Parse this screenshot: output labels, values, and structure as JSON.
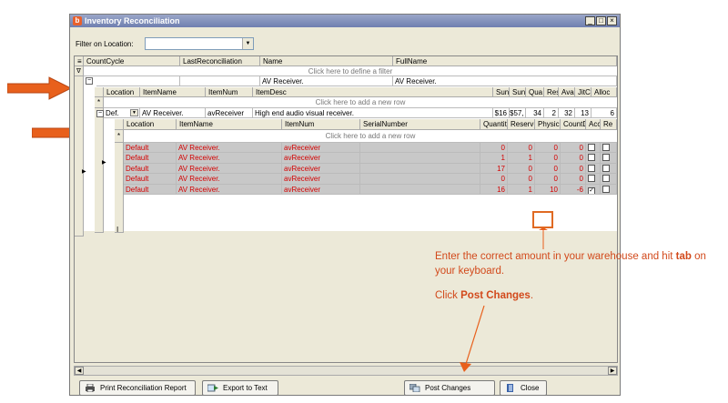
{
  "window": {
    "title": "Inventory Reconciliation",
    "icon_letter": "b",
    "buttons": [
      "_",
      "□",
      "×"
    ]
  },
  "filter": {
    "label": "Filter on Location:",
    "value": ""
  },
  "top_grid": {
    "columns": [
      "CountCycle",
      "LastReconciliation",
      "Name",
      "FullName"
    ],
    "filter_row_text": "Click here to define a filter",
    "row": {
      "expander": "−",
      "name": "AV Receiver.",
      "fullname": "AV Receiver."
    }
  },
  "item_grid": {
    "columns": [
      "Location",
      "ItemName",
      "ItemNum",
      "ItemDesc",
      "Sun",
      "Sun",
      "Qua",
      "Res",
      "Avail",
      "JitC",
      "Alloc"
    ],
    "add_row_text": "Click here to add a new row",
    "row": {
      "location": "Def.",
      "itemname": "AV Receiver.",
      "itemnum": "avReceiver",
      "itemdesc": "High end audio visual receiver.",
      "sun1": "$16",
      "sun2": "$57,",
      "qua": "34",
      "res": "2",
      "avail": "32",
      "jitc": "13",
      "alloc": "6"
    }
  },
  "serial_grid": {
    "columns": [
      "Location",
      "ItemName",
      "ItemNum",
      "SerialNumber",
      "Quantit",
      "Reserv",
      "Physic",
      "CountD",
      "Acc",
      "Re"
    ],
    "add_row_text": "Click here to add a new row",
    "rows": [
      {
        "location": "Default",
        "itemname": "AV Receiver.",
        "itemnum": "avReceiver",
        "serial": "",
        "quantity": "0",
        "reserved": "0",
        "physical": "0",
        "countd": "0",
        "acc": false
      },
      {
        "location": "Default",
        "itemname": "AV Receiver.",
        "itemnum": "avReceiver",
        "serial": "",
        "quantity": "1",
        "reserved": "1",
        "physical": "0",
        "countd": "0",
        "acc": false
      },
      {
        "location": "Default",
        "itemname": "AV Receiver.",
        "itemnum": "avReceiver",
        "serial": "",
        "quantity": "17",
        "reserved": "0",
        "physical": "0",
        "countd": "0",
        "acc": false
      },
      {
        "location": "Default",
        "itemname": "AV Receiver.",
        "itemnum": "avReceiver",
        "serial": "",
        "quantity": "0",
        "reserved": "0",
        "physical": "0",
        "countd": "0",
        "acc": false
      },
      {
        "location": "Default",
        "itemname": "AV Receiver.",
        "itemnum": "avReceiver",
        "serial": "",
        "quantity": "16",
        "reserved": "1",
        "physical": "10",
        "countd": "-6",
        "acc": true
      }
    ]
  },
  "footer": {
    "print_label": "Print Reconciliation Report",
    "export_label": "Export to Text",
    "post_label": "Post Changes",
    "close_label": "Close"
  },
  "annotations": {
    "note1_pre": "Enter the correct amount in your warehouse and hit ",
    "note1_bold": "tab",
    "note1_post": " on your keyboard.",
    "note2_pre": "Click ",
    "note2_bold": "Post Changes",
    "note2_post": ".",
    "arrow_color": "#e8601c",
    "text_color": "#d2491b"
  }
}
